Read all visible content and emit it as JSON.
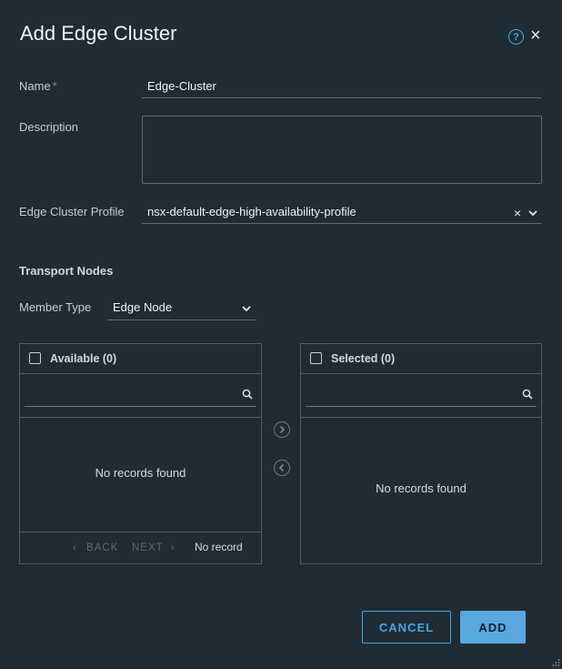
{
  "dialog": {
    "title": "Add Edge Cluster",
    "help_icon": "?",
    "close_icon": "×"
  },
  "form": {
    "name_label": "Name",
    "required_mark": "*",
    "name_value": "Edge-Cluster",
    "description_label": "Description",
    "description_value": "",
    "profile_label": "Edge Cluster Profile",
    "profile_value": "nsx-default-edge-high-availability-profile",
    "profile_clear": "×"
  },
  "transport_nodes": {
    "section_title": "Transport Nodes",
    "member_type_label": "Member Type",
    "member_type_value": "Edge Node",
    "available": {
      "title": "Available (0)",
      "empty_text": "No records found",
      "back_label": "BACK",
      "next_label": "NEXT",
      "record_info": "No record",
      "back_arrow": "‹",
      "next_arrow": "›"
    },
    "selected": {
      "title": "Selected (0)",
      "empty_text": "No records found"
    }
  },
  "footer": {
    "cancel_label": "CANCEL",
    "add_label": "ADD"
  },
  "colors": {
    "background": "#1f2c36",
    "accent": "#4aa3df",
    "primary_button": "#5aa8e0",
    "required": "#e0646a"
  }
}
